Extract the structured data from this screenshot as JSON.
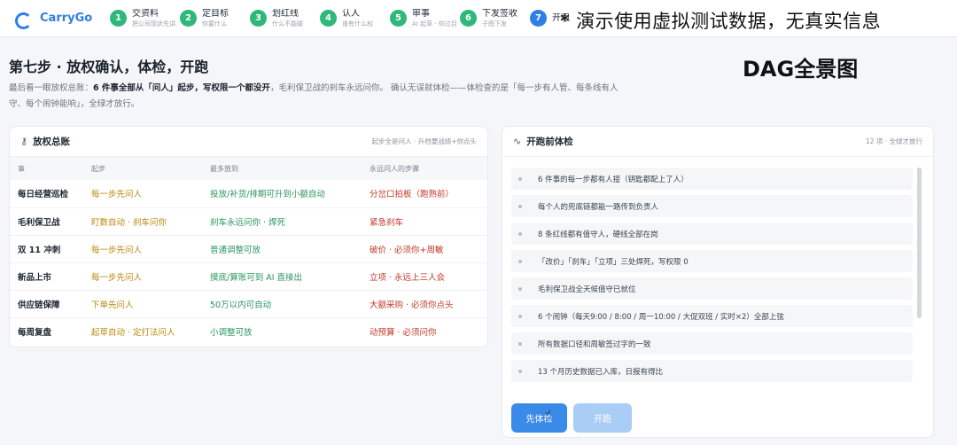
{
  "app": {
    "name": "CarryGo"
  },
  "steps": [
    {
      "num": "1",
      "title": "交资料",
      "sub": "把公司现状先讲来",
      "state": "done"
    },
    {
      "num": "2",
      "title": "定目标",
      "sub": "你要什么",
      "state": "done"
    },
    {
      "num": "3",
      "title": "划红线",
      "sub": "什么不能碰",
      "state": "done"
    },
    {
      "num": "4",
      "title": "认人",
      "sub": "谁有什么权",
      "state": "done"
    },
    {
      "num": "5",
      "title": "审事",
      "sub": "AI 起草 · 你过目",
      "state": "done"
    },
    {
      "num": "6",
      "title": "下发签收",
      "sub": "子图下发",
      "state": "done"
    },
    {
      "num": "7",
      "title": "开跑",
      "sub": "",
      "state": "current"
    }
  ],
  "overlay": {
    "watermark": "* 演示使用虚拟测试数据，无真实信息",
    "dag": "DAG全景图"
  },
  "page": {
    "title": "第七步 · 放权确认，体检，开跑",
    "desc_prefix": "最后看一眼放权总账：",
    "desc_bold": "6 件事全部从「问人」起步，写权限一个都没开",
    "desc_rest": "，毛利保卫战的刹车永远问你。 确认无误就体检——体检查的是「每一步有人管、每条线有人守、每个闹钟能响」，全绿才放行。"
  },
  "ledger": {
    "title": "放权总账",
    "note": "起步全是问人 · 升档要战绩+你点头",
    "columns": [
      "事",
      "起步",
      "最多放到",
      "永远问人的步骤"
    ],
    "rows": [
      {
        "name": "每日经营巡检",
        "start": "每一步先问人",
        "max": "投放/补货/排期可升到小额自动",
        "never": "分岔口拍板（跑熟前）"
      },
      {
        "name": "毛利保卫战",
        "start": "盯数自动 · 刹车问你",
        "max": "刹车永远问你 · 焊死",
        "never": "紧急刹车"
      },
      {
        "name": "双 11 冲刺",
        "start": "每一步先问人",
        "max": "普通调整可放",
        "never": "破价 · 必须你+周敏"
      },
      {
        "name": "新品上市",
        "start": "每一步先问人",
        "max": "摸底/算账可到 AI 直接出",
        "never": "立项 · 永远上三人会"
      },
      {
        "name": "供应链保障",
        "start": "下单先问人",
        "max": "50万以内可自动",
        "never": "大额采购 · 必须你点头"
      },
      {
        "name": "每周复盘",
        "start": "起草自动 · 定打法问人",
        "max": "小调整可放",
        "never": "动预算 · 必须问你"
      }
    ]
  },
  "precheck": {
    "title": "开跑前体检",
    "note": "12 项 · 全绿才放行",
    "items": [
      "6 件事的每一步都有人接（钥匙都配上了人）",
      "每个人的兜底链都能一路传到负责人",
      "8 条红线都有值守人，硬线全部在岗",
      "「改价」「刹车」「立项」三处焊死，写权限 0",
      "毛利保卫战全天候值守已就位",
      "6 个闹钟（每天9:00 / 8:00 / 周一10:00 / 大促双班 / 实时×2）全部上弦",
      "所有数据口径和周敏签过字的一致",
      "13 个月历史数据已入库，日报有得比"
    ],
    "btn_check": "先体检",
    "btn_run": "开跑"
  }
}
